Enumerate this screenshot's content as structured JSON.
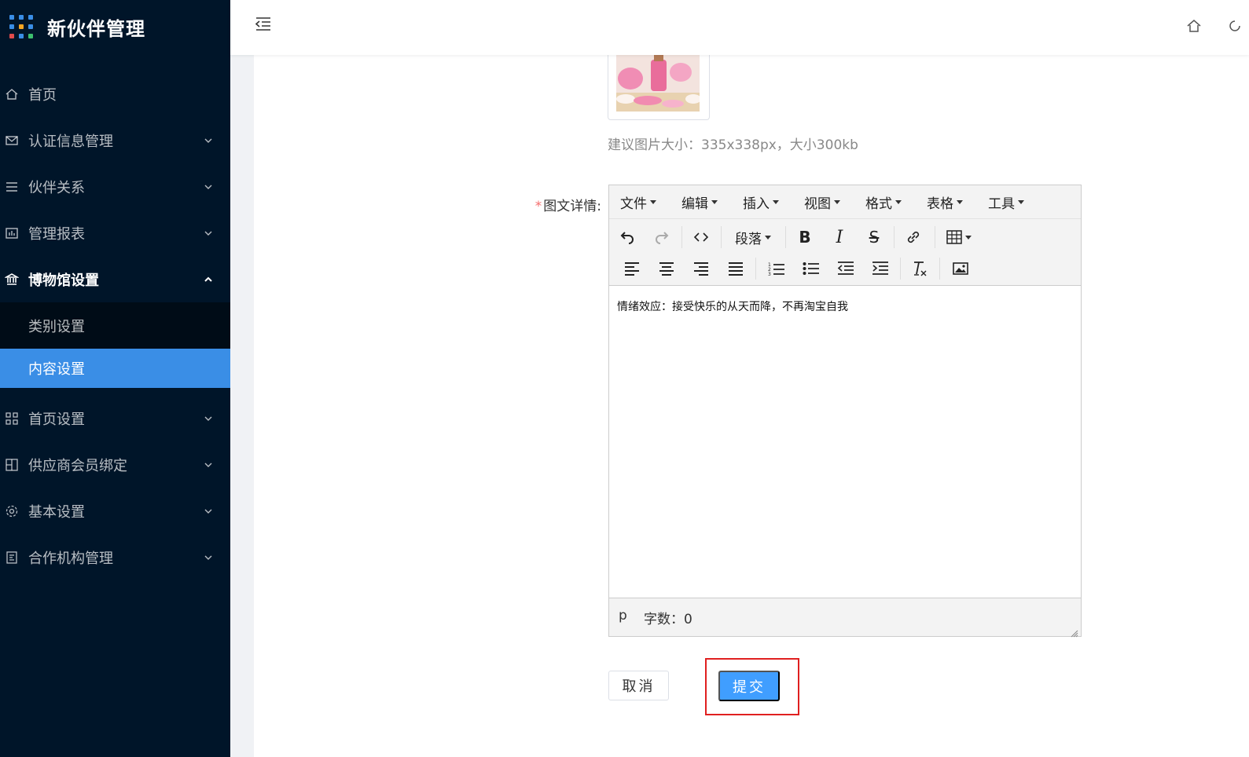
{
  "app": {
    "title": "新伙伴管理"
  },
  "sidebar": {
    "items": [
      {
        "label": "首页",
        "icon": "home-icon"
      },
      {
        "label": "认证信息管理",
        "icon": "mail-icon"
      },
      {
        "label": "伙伴关系",
        "icon": "list-icon"
      },
      {
        "label": "管理报表",
        "icon": "report-icon"
      },
      {
        "label": "博物馆设置",
        "icon": "museum-icon"
      },
      {
        "label": "首页设置",
        "icon": "grid-icon"
      },
      {
        "label": "供应商会员绑定",
        "icon": "binding-icon"
      },
      {
        "label": "基本设置",
        "icon": "gear-icon"
      },
      {
        "label": "合作机构管理",
        "icon": "org-icon"
      }
    ],
    "submenu": [
      {
        "label": "类别设置"
      },
      {
        "label": "内容设置"
      }
    ]
  },
  "form": {
    "image_hint": "建议图片大小：335x338px，大小300kb",
    "detail_label": "图文详情:",
    "required_mark": "*"
  },
  "editor": {
    "menus": [
      "文件",
      "编辑",
      "插入",
      "视图",
      "格式",
      "表格",
      "工具"
    ],
    "paragraph_label": "段落",
    "content": "情绪效应：接受快乐的从天而降，不再淘宝自我",
    "status_path": "p",
    "word_count": "字数：0"
  },
  "actions": {
    "cancel": "取消",
    "submit": "提交"
  },
  "colors": {
    "sidebar_bg": "#001529",
    "active": "#3a8ee6",
    "primary": "#409eff",
    "highlight": "#e02020"
  }
}
